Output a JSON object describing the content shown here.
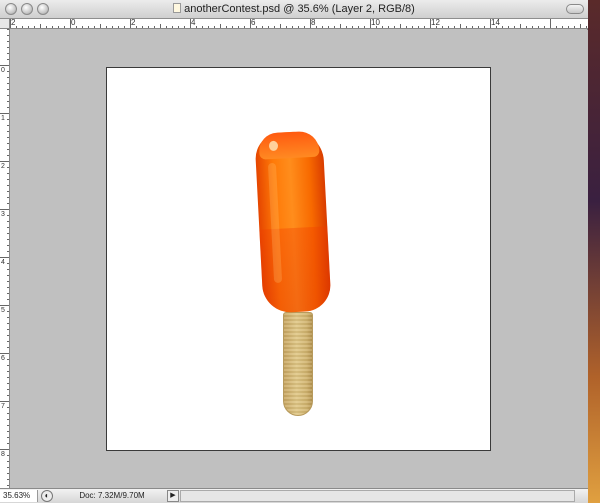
{
  "window": {
    "title": "anotherContest.psd @ 35.6% (Layer 2, RGB/8)"
  },
  "rulers": {
    "horizontal_labels": [
      "2",
      "0",
      "2",
      "4",
      "6",
      "8",
      "10",
      "12",
      "14"
    ],
    "vertical_labels": [
      "0",
      "1",
      "2",
      "3",
      "4",
      "5",
      "6",
      "7",
      "8"
    ]
  },
  "statusbar": {
    "zoom": "35.63%",
    "doc_info": "Doc: 7.32M/9.70M",
    "arrow": "▶"
  },
  "icons": {
    "close": "close-icon",
    "minimize": "minimize-icon",
    "zoom": "zoom-icon",
    "doc": "document-icon",
    "zoom_toggle": "zoom-toggle-icon"
  },
  "colors": {
    "popsicle": "#ff7a08",
    "stick": "#d8bd76",
    "canvas": "#ffffff",
    "pasteboard": "#c0c0c0"
  }
}
